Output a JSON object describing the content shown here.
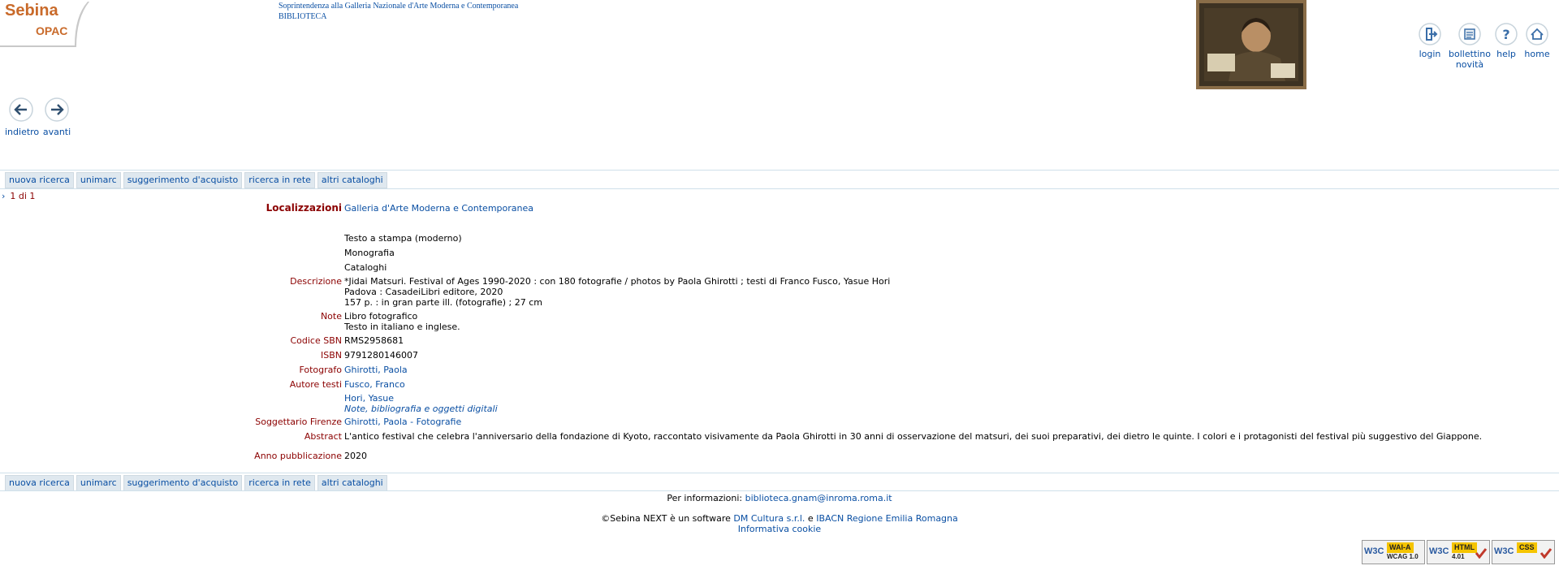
{
  "logo": {
    "line1": "Sebina",
    "line2": "OPAC"
  },
  "header": {
    "line1": "Soprintendenza alla Galleria Nazionale d'Arte Moderna e Contemporanea",
    "line2": "BIBLIOTECA"
  },
  "top_icons": {
    "login": "login",
    "bollettino_line1": "bollettino",
    "bollettino_line2": "novità",
    "help": "help",
    "home": "home"
  },
  "nav": {
    "back": "indietro",
    "forward": "avanti"
  },
  "menu": [
    "nuova ricerca",
    "unimarc",
    "suggerimento d'acquisto",
    "ricerca in rete",
    "altri cataloghi"
  ],
  "pager": "1 di 1",
  "record": {
    "localizzazioni_label": "Localizzazioni",
    "localizzazioni_value": "Galleria d'Arte Moderna e Contemporanea",
    "type1": "Testo a stampa (moderno)",
    "type2": "Monografia",
    "type3": "Cataloghi",
    "descrizione_label": "Descrizione",
    "descrizione_1": "*Jidai Matsuri. Festival of Ages 1990-2020 : con 180 fotografie / photos by Paola Ghirotti ; testi di Franco Fusco, Yasue Hori",
    "descrizione_2": "Padova : CasadeiLibri editore, 2020",
    "descrizione_3": "157 p. : in gran parte ill. (fotografie) ; 27 cm",
    "note_label": "Note",
    "note_1": "Libro fotografico",
    "note_2": "Testo in italiano e inglese.",
    "sbn_label": "Codice SBN",
    "sbn_value": "RMS2958681",
    "isbn_label": "ISBN",
    "isbn_value": "9791280146007",
    "fotografo_label": "Fotografo",
    "fotografo_value": "Ghirotti, Paola",
    "autore_label": "Autore testi",
    "autore_1": "Fusco, Franco",
    "autore_2": "Hori, Yasue",
    "autore_note": "Note, bibliografia e oggetti digitali",
    "soggettario_label": "Soggettario Firenze",
    "soggettario_value": "Ghirotti, Paola - Fotografie",
    "abstract_label": "Abstract",
    "abstract_value": "L'antico festival che celebra l'anniversario della fondazione di Kyoto, raccontato visivamente da Paola Ghirotti in 30 anni di osservazione del matsuri, dei suoi preparativi, dei dietro le quinte. I colori e i protagonisti del festival più suggestivo del Giappone.",
    "anno_label": "Anno pubblicazione",
    "anno_value": "2020"
  },
  "footer": {
    "info_prefix": "Per informazioni:",
    "info_email": "biblioteca.gnam@inroma.roma.it",
    "credits_prefix": "©Sebina NEXT è un software",
    "credits_link1": "DM Cultura s.r.l.",
    "credits_mid": "e",
    "credits_link2": "IBACN Regione Emilia Romagna",
    "cookie": "Informativa cookie"
  },
  "badges": [
    {
      "w3c": "W3C",
      "title": "WAI-A",
      "sub": "WCAG 1.0"
    },
    {
      "w3c": "W3C",
      "title": "HTML",
      "sub": "4.01"
    },
    {
      "w3c": "W3C",
      "title": "CSS",
      "sub": ""
    }
  ]
}
